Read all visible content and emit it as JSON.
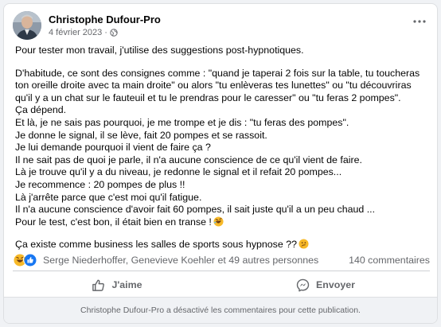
{
  "post": {
    "author": "Christophe Dufour-Pro",
    "date": "4 février 2023",
    "dot": "·",
    "privacy_icon": "globe-icon",
    "more_icon": "more-dots-icon",
    "paragraphs": [
      "Pour tester mon travail, j'utilise des suggestions post-hypnotiques.",
      "D'habitude, ce sont des consignes comme : \"quand je taperai 2 fois sur la table, tu toucheras ton oreille droite avec ta main droite\" ou alors \"tu enlèveras tes lunettes\" ou \"tu découvriras qu'il y a un chat sur le fauteuil et tu le prendras pour le caresser\" ou \"tu feras 2 pompes\".\nÇa dépend.\nEt là, je ne sais pas pourquoi, je me trompe et je dis : \"tu feras des pompes\".\nJe donne le signal, il se lève, fait 20 pompes et se rassoit.\nJe lui demande pourquoi il vient de faire ça ?\nIl ne sait pas de quoi je parle, il n'a aucune conscience de ce qu'il vient de faire.\nLà je trouve qu'il y a du niveau, je redonne le signal et il refait 20 pompes...\nJe recommence : 20 pompes de plus !!\nLà j'arrête parce que c'est moi qu'il fatigue.\nIl n'a aucune conscience d'avoir fait 60 pompes, il sait juste qu'il a un peu chaud ...\nPour le test, c'est bon, il était bien en transe !",
      "Ça existe comme business les salles de sports sous hypnose ??"
    ],
    "emoji_1": "rofl-emoji",
    "emoji_2": "thinking-emoji"
  },
  "stats": {
    "reaction_icons": [
      "haha-icon",
      "like-icon"
    ],
    "reaction_names": "Serge Niederhoffer, Genevieve Koehler et 49 autres personnes",
    "comment_count": "140 commentaires"
  },
  "actions": {
    "like_label": "J'aime",
    "like_icon": "thumbs-up-icon",
    "share_label": "Envoyer",
    "share_icon": "messenger-icon"
  },
  "footer": {
    "notice": "Christophe Dufour-Pro a désactivé les commentaires pour cette publication."
  },
  "colors": {
    "text_primary": "#050505",
    "text_secondary": "#65676b",
    "like_blue": "#1877f2",
    "haha_yellow": "#f7b928",
    "divider": "#ced0d4",
    "page_bg": "#f0f2f5"
  }
}
